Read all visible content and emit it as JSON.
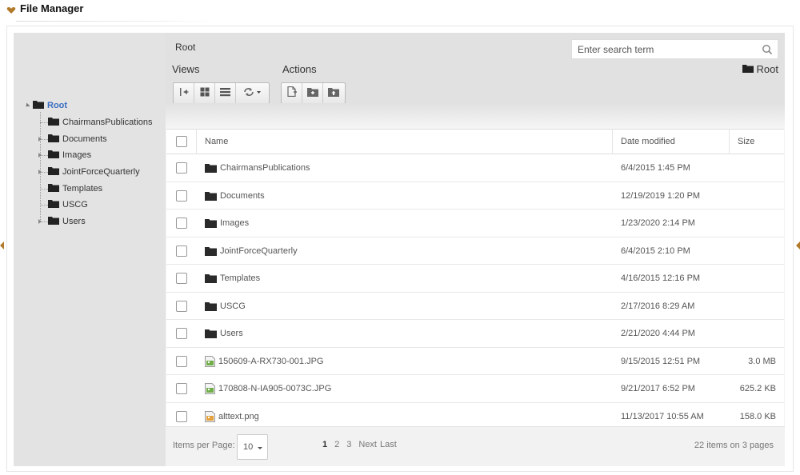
{
  "app": {
    "title": "File Manager"
  },
  "tree": {
    "root_label": "Root",
    "items": [
      {
        "label": "ChairmansPublications",
        "expandable": false
      },
      {
        "label": "Documents",
        "expandable": true
      },
      {
        "label": "Images",
        "expandable": true
      },
      {
        "label": "JointForceQuarterly",
        "expandable": true
      },
      {
        "label": "Templates",
        "expandable": false
      },
      {
        "label": "USCG",
        "expandable": false
      },
      {
        "label": "Users",
        "expandable": true
      }
    ]
  },
  "toolbar": {
    "breadcrumb": "Root",
    "search_placeholder": "Enter search term",
    "views_label": "Views",
    "actions_label": "Actions",
    "current_folder": "Root"
  },
  "table": {
    "columns": {
      "name": "Name",
      "date": "Date modified",
      "size": "Size"
    },
    "rows": [
      {
        "name": "ChairmansPublications",
        "date": "6/4/2015 1:45 PM",
        "size": "",
        "type": "folder"
      },
      {
        "name": "Documents",
        "date": "12/19/2019 1:20 PM",
        "size": "",
        "type": "folder"
      },
      {
        "name": "Images",
        "date": "1/23/2020 2:14 PM",
        "size": "",
        "type": "folder"
      },
      {
        "name": "JointForceQuarterly",
        "date": "6/4/2015 2:10 PM",
        "size": "",
        "type": "folder"
      },
      {
        "name": "Templates",
        "date": "4/16/2015 12:16 PM",
        "size": "",
        "type": "folder"
      },
      {
        "name": "USCG",
        "date": "2/17/2016 8:29 AM",
        "size": "",
        "type": "folder"
      },
      {
        "name": "Users",
        "date": "2/21/2020 4:44 PM",
        "size": "",
        "type": "folder"
      },
      {
        "name": "150609-A-RX730-001.JPG",
        "date": "9/15/2015 12:51 PM",
        "size": "3.0 MB",
        "type": "image"
      },
      {
        "name": "170808-N-IA905-0073C.JPG",
        "date": "9/21/2017 6:52 PM",
        "size": "625.2 KB",
        "type": "image"
      },
      {
        "name": "alttext.png",
        "date": "11/13/2017 10:55 AM",
        "size": "158.0 KB",
        "type": "png"
      }
    ]
  },
  "footer": {
    "items_per_page_label": "Items per Page:",
    "items_per_page_value": "10",
    "pages": [
      "1",
      "2",
      "3"
    ],
    "next_label": "Next",
    "last_label": "Last",
    "items_info": "22 items on 3 pages"
  },
  "colors": {
    "root_link": "#3a6ec0",
    "tree_bg": "#e3e3e3",
    "toolbar_bg": "#e1e1e1",
    "accent_arrow": "#b07a28"
  }
}
